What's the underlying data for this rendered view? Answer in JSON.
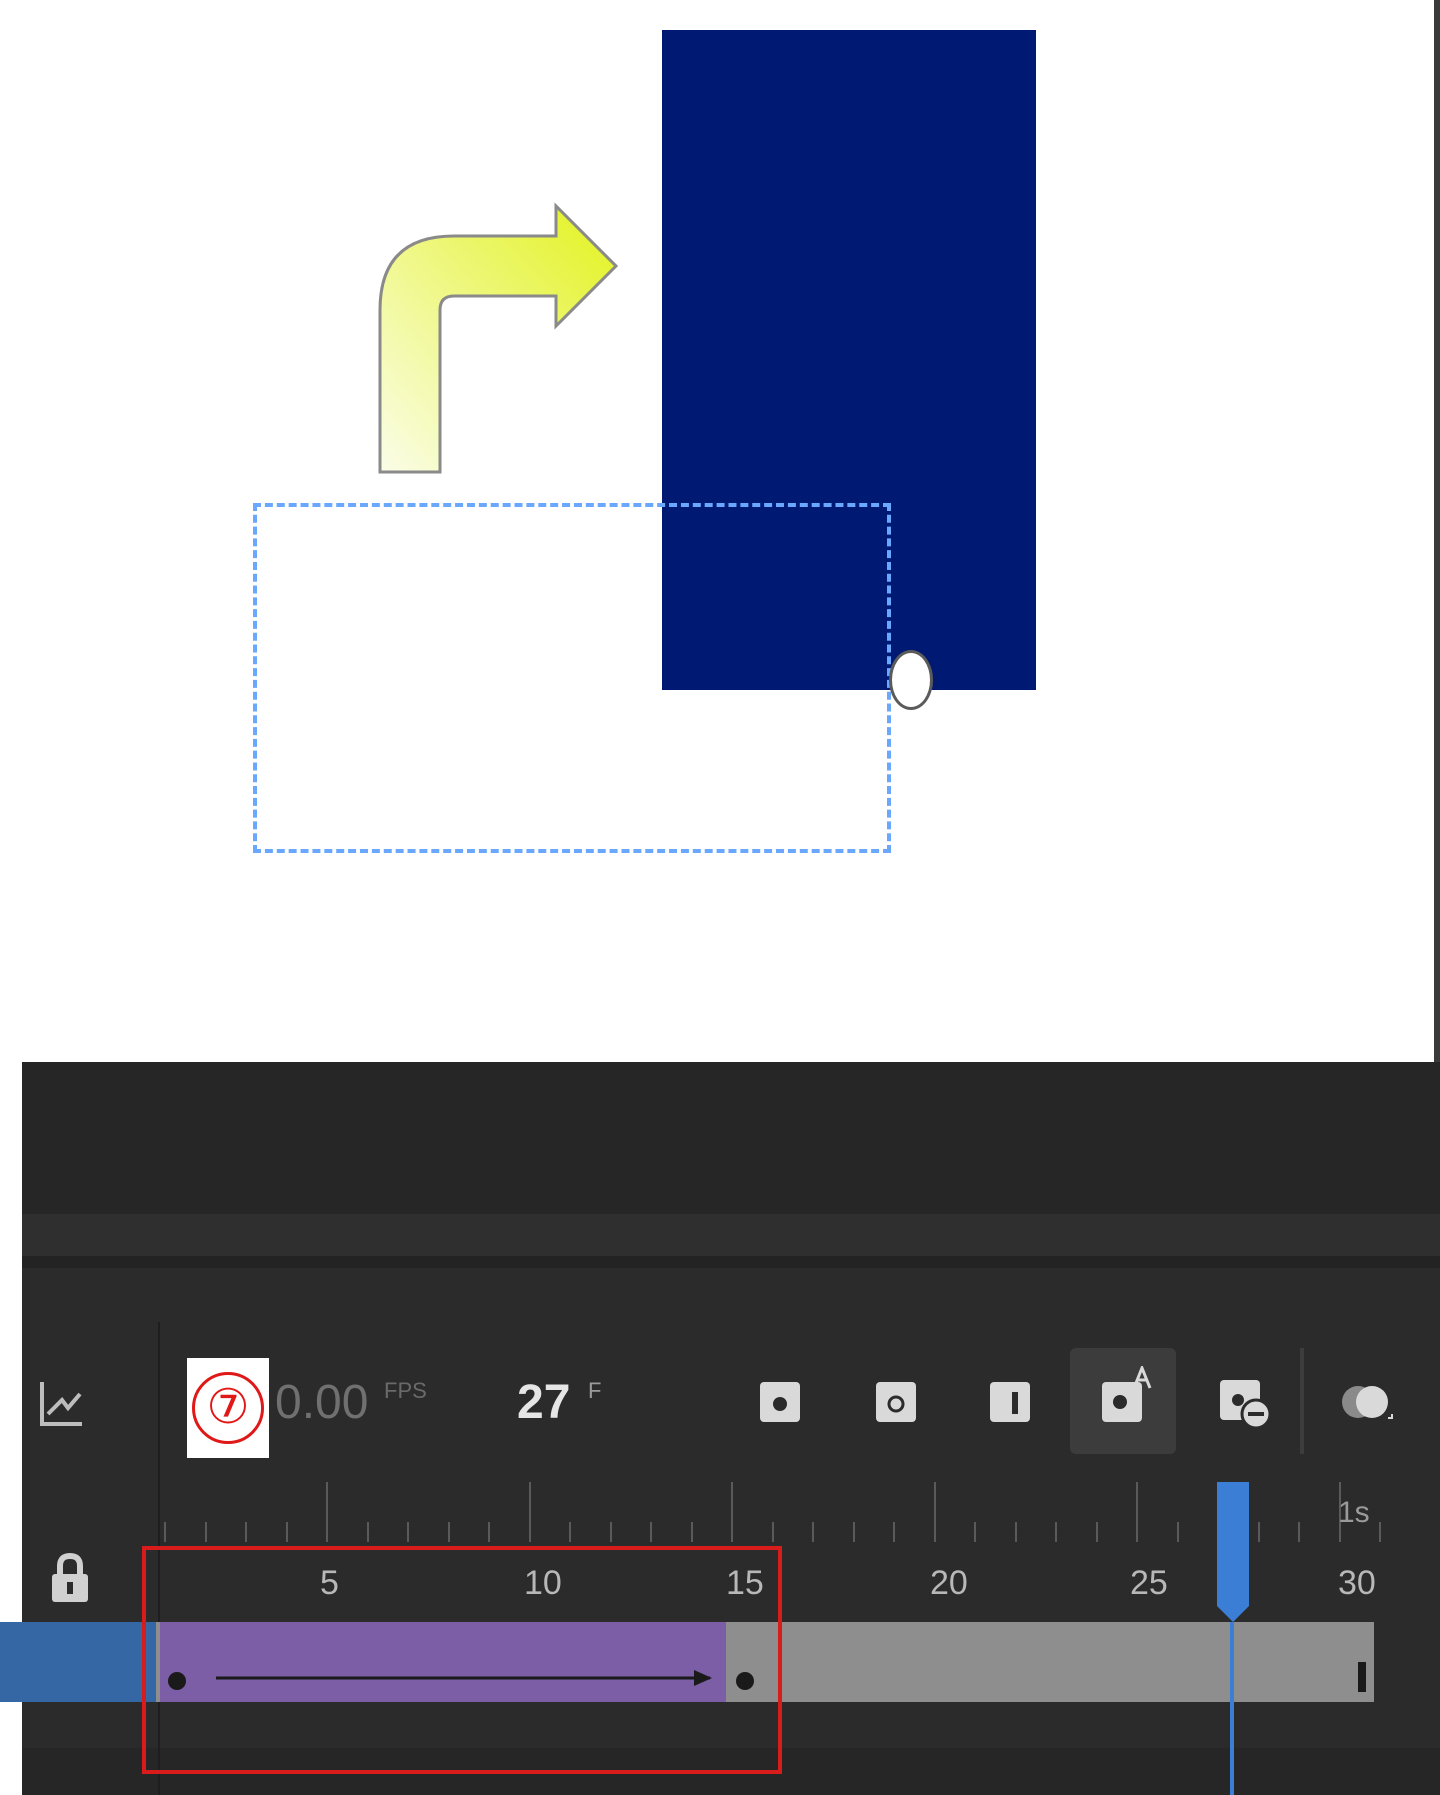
{
  "toolbar": {
    "annotation_number": "⑦",
    "fps_value": "0.00",
    "fps_unit": "FPS",
    "frame_value": "27",
    "frame_unit": "F",
    "tools": [
      "insert-keyframe-icon",
      "insert-blank-keyframe-icon",
      "insert-frame-icon",
      "auto-keyframe-icon",
      "remove-frame-icon",
      "onion-skin-icon"
    ]
  },
  "timeline": {
    "frame_labels": [
      "5",
      "10",
      "15",
      "20",
      "25",
      "30"
    ],
    "seconds_label": "1s",
    "current_frame": 27,
    "tween_start_frame": 1,
    "tween_end_frame": 15,
    "last_frame": 30
  },
  "colors": {
    "rectangle": "#001a73",
    "tween_span": "#7b5ea6",
    "playhead": "#3a7fd5",
    "annotation": "#e01818"
  }
}
